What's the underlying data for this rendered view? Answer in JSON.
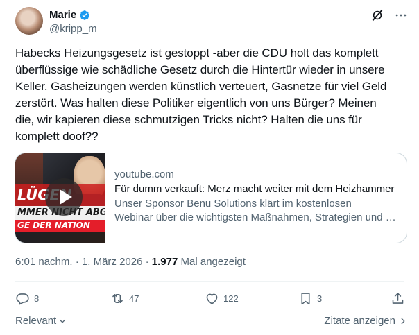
{
  "author": {
    "display_name": "Marie",
    "handle": "@kripp_m",
    "verified": true
  },
  "tweet": {
    "text": "Habecks Heizungsgesetz ist gestoppt -aber die CDU holt das komplett\nüberflüssige wie schädliche Gesetz durch die Hintertür wieder in unsere\nKeller. Gasheizungen werden künstlich verteuert, Gasnetze für viel Geld\nzerstört. Was halten diese Politiker eigentlich von uns Bürger? Meinen\ndie, wir kapieren diese schmutzigen Tricks nicht? Halten die uns für\nkomplett doof??"
  },
  "link_card": {
    "domain": "youtube.com",
    "title": "Für dumm verkauft: Merz macht weiter mit dem Heizhammer",
    "description_line1": "Unser Sponsor Benu Solutions klärt im kostenlosen",
    "description_line2": "Webinar über die wichtigsten Maßnahmen, Strategien und Optionen",
    "thumbnail_text_1": "LÜGEN",
    "thumbnail_text_2": "MMER NICHT ABGESC",
    "thumbnail_text_3": "GE DER NATION"
  },
  "meta": {
    "time": "6:01 nachm.",
    "separator": "·",
    "date": "1. März 2026",
    "views_count": "1.977",
    "views_label": "Mal angezeigt"
  },
  "actions": {
    "replies": "8",
    "reposts": "47",
    "likes": "122",
    "bookmarks": "3"
  },
  "footer": {
    "relevant_label": "Relevant",
    "quotes_label": "Zitate anzeigen"
  },
  "colors": {
    "verified_blue": "#1d9bf0",
    "text_primary": "#0f1419",
    "text_secondary": "#536471",
    "border": "#cfd9de"
  },
  "icons": [
    "verified-badge-icon",
    "grok-icon",
    "more-icon",
    "play-icon",
    "reply-icon",
    "repost-icon",
    "like-icon",
    "bookmark-icon",
    "share-icon",
    "chevron-down-icon",
    "chevron-right-icon"
  ]
}
